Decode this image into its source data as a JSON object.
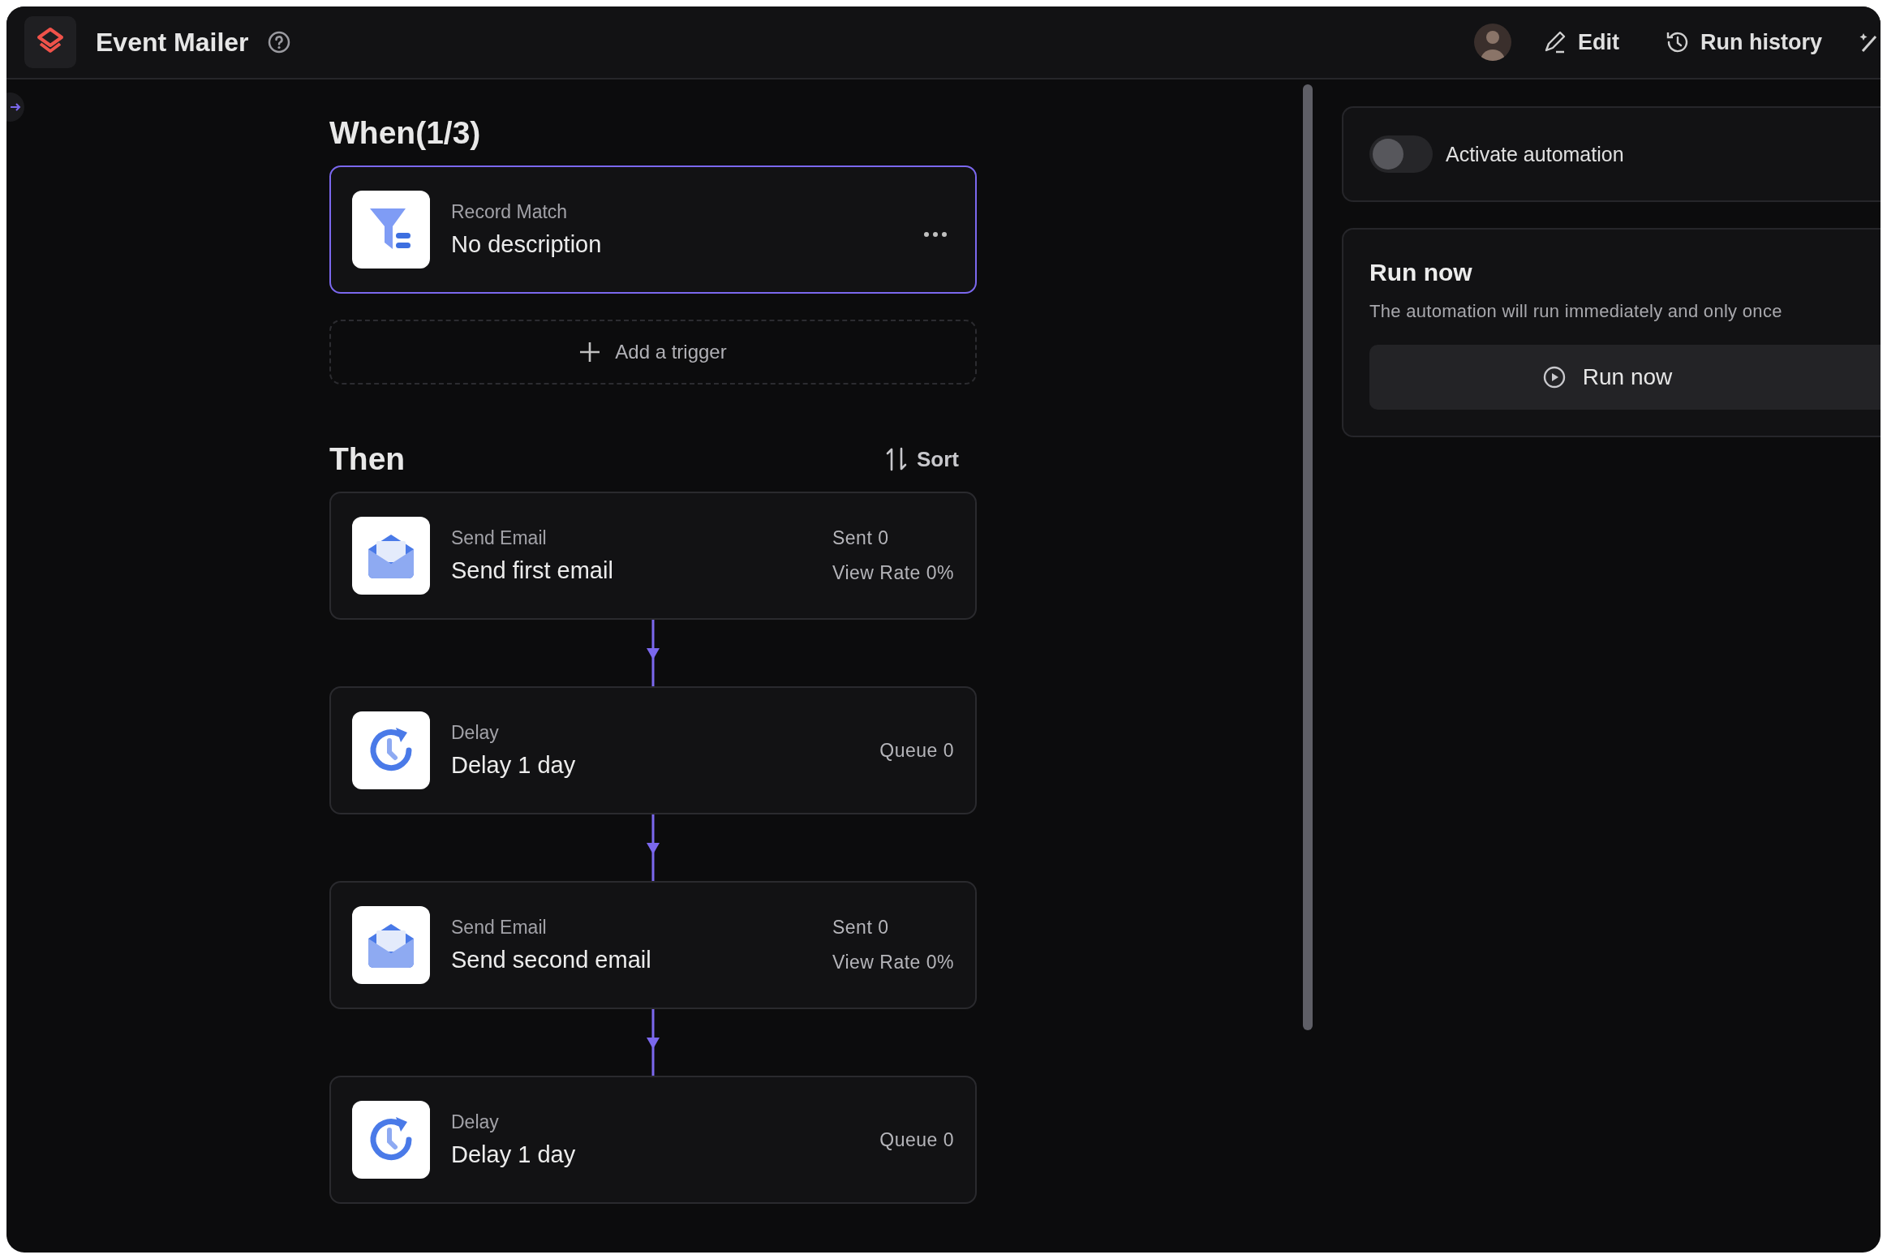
{
  "header": {
    "title": "Event Mailer",
    "actions": [
      {
        "label": "Edit",
        "kind": "edit"
      },
      {
        "label": "Run history",
        "kind": "history"
      }
    ]
  },
  "when": {
    "heading": "When(1/3)",
    "triggers": [
      {
        "kind": "filter",
        "type": "Record Match",
        "name": "No description",
        "selected": true
      }
    ],
    "add_label": "Add a trigger"
  },
  "then": {
    "heading": "Then",
    "sort_label": "Sort",
    "steps": [
      {
        "kind": "email",
        "type": "Send Email",
        "name": "Send first email",
        "stats": [
          "Sent 0",
          "View Rate 0%"
        ],
        "selected": false
      },
      {
        "kind": "delay",
        "type": "Delay",
        "name": "Delay 1 day",
        "stats": [
          "Queue 0"
        ],
        "selected": false
      },
      {
        "kind": "email",
        "type": "Send Email",
        "name": "Send second email",
        "stats": [
          "Sent 0",
          "View Rate 0%"
        ],
        "selected": false
      },
      {
        "kind": "delay",
        "type": "Delay",
        "name": "Delay 1 day",
        "stats": [
          "Queue 0"
        ],
        "selected": false
      }
    ]
  },
  "activation": {
    "label": "Activate automation",
    "on": false
  },
  "run_now": {
    "title": "Run now",
    "description": "The automation will run immediately and only once",
    "button": "Run now"
  }
}
